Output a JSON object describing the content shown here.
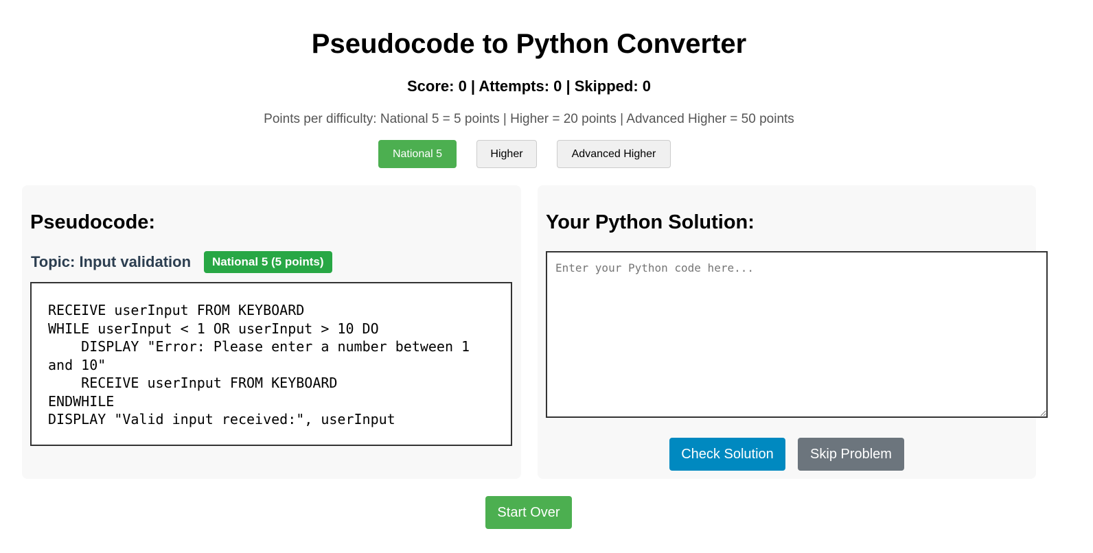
{
  "header": {
    "title": "Pseudocode to Python Converter",
    "score_line": "Score: 0 | Attempts: 0 | Skipped: 0",
    "points_info": "Points per difficulty: National 5 = 5 points | Higher = 20 points | Advanced Higher = 50 points"
  },
  "difficulty": {
    "selected": "National 5",
    "buttons": [
      {
        "label": "National 5"
      },
      {
        "label": "Higher"
      },
      {
        "label": "Advanced Higher"
      }
    ]
  },
  "pseudocode_panel": {
    "heading": "Pseudocode:",
    "topic_label": "Topic: Input validation",
    "badge": "National 5 (5 points)",
    "code": "RECEIVE userInput FROM KEYBOARD\nWHILE userInput < 1 OR userInput > 10 DO\n    DISPLAY \"Error: Please enter a number between 1 and 10\"\n    RECEIVE userInput FROM KEYBOARD\nENDWHILE\nDISPLAY \"Valid input received:\", userInput"
  },
  "solution_panel": {
    "heading": "Your Python Solution:",
    "input_value": "",
    "input_placeholder": "Enter your Python code here...",
    "check_label": "Check Solution",
    "skip_label": "Skip Problem"
  },
  "footer": {
    "start_over_label": "Start Over"
  },
  "colors": {
    "primary_green": "#4caf50",
    "badge_green": "#28a745",
    "check_blue": "#0089c0",
    "skip_gray": "#6c757d",
    "topic_color": "#2c3e50"
  }
}
